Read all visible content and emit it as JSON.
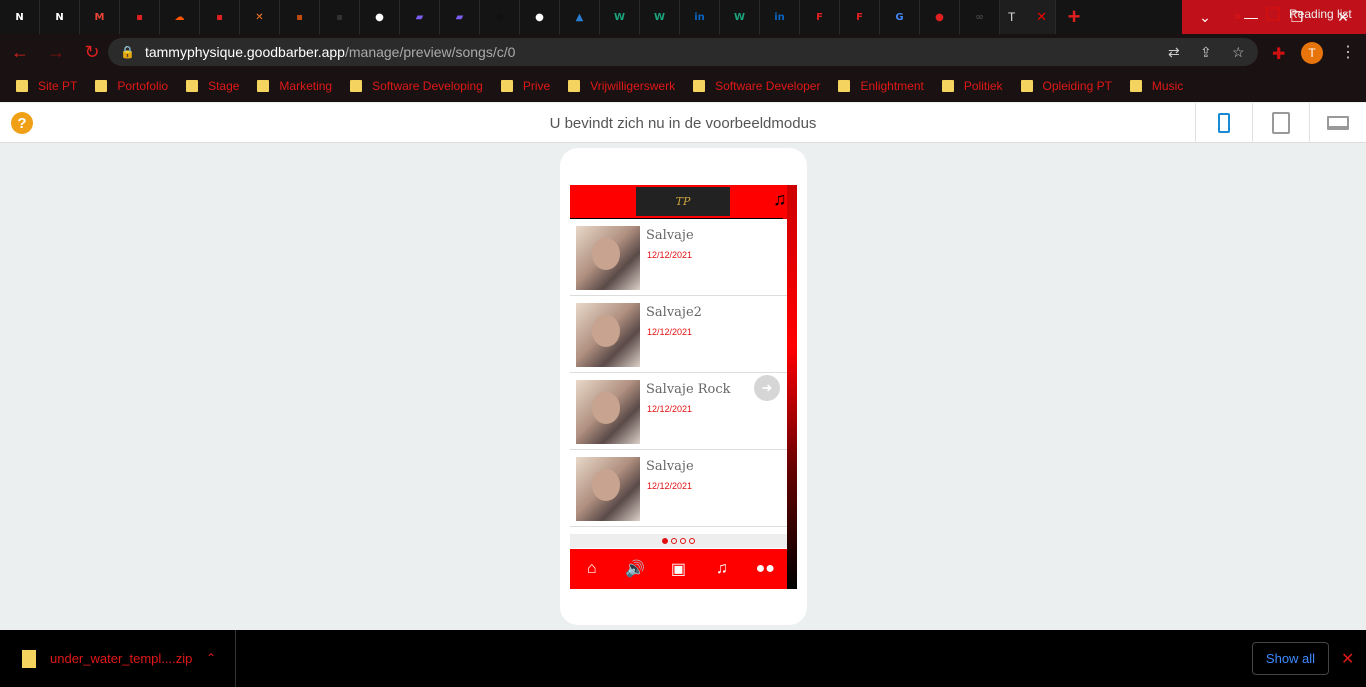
{
  "browser": {
    "tabs": [
      {
        "icon": "nch-icon",
        "color": "#ffffff",
        "glyph": "N"
      },
      {
        "icon": "nch-icon",
        "color": "#ffffff",
        "glyph": "N"
      },
      {
        "icon": "gmail-icon",
        "color": "#ea4335",
        "glyph": "M"
      },
      {
        "icon": "app-icon",
        "color": "#e02020",
        "glyph": "▪"
      },
      {
        "icon": "soundcloud-icon",
        "color": "#ff5500",
        "glyph": "☁"
      },
      {
        "icon": "app-icon",
        "color": "#e02020",
        "glyph": "▪"
      },
      {
        "icon": "xampp-icon",
        "color": "#fb7a24",
        "glyph": "✕"
      },
      {
        "icon": "app-icon",
        "color": "#c04a10",
        "glyph": "▪"
      },
      {
        "icon": "app-icon",
        "color": "#333333",
        "glyph": "▪"
      },
      {
        "icon": "github-icon",
        "color": "#ffffff",
        "glyph": "●"
      },
      {
        "icon": "app-icon",
        "color": "#7b5cf0",
        "glyph": "▰"
      },
      {
        "icon": "app-icon",
        "color": "#7b5cf0",
        "glyph": "▰"
      },
      {
        "icon": "app-icon",
        "color": "#111111",
        "glyph": "●"
      },
      {
        "icon": "github-icon",
        "color": "#ffffff",
        "glyph": "●"
      },
      {
        "icon": "app-icon",
        "color": "#2a7fd4",
        "glyph": "▲"
      },
      {
        "icon": "w-icon",
        "color": "#1aa37a",
        "glyph": "W"
      },
      {
        "icon": "w-icon",
        "color": "#1aa37a",
        "glyph": "W"
      },
      {
        "icon": "linkedin-icon",
        "color": "#0a66c2",
        "glyph": "in"
      },
      {
        "icon": "w-icon",
        "color": "#1aa37a",
        "glyph": "W"
      },
      {
        "icon": "linkedin-icon",
        "color": "#0a66c2",
        "glyph": "in"
      },
      {
        "icon": "f-icon",
        "color": "#e02020",
        "glyph": "F"
      },
      {
        "icon": "f-icon",
        "color": "#e02020",
        "glyph": "F"
      },
      {
        "icon": "google-icon",
        "color": "#4285f4",
        "glyph": "G"
      },
      {
        "icon": "app-icon",
        "color": "#e02020",
        "glyph": "●"
      },
      {
        "icon": "app-icon",
        "color": "#444444",
        "glyph": "∞"
      }
    ],
    "active_tab": {
      "label": "T",
      "close": "✕"
    },
    "new_tab": "+",
    "window": {
      "dropdown": "⌄",
      "minimize": "—",
      "restore": "❐",
      "close": "✕"
    },
    "address": {
      "host": "tammyphysique.goodbarber.app",
      "path": "/manage/preview/songs/c/0"
    },
    "profile_initial": "T",
    "bookmarks": [
      "Site PT",
      "Portofolio",
      "Stage",
      "Marketing",
      "Software Developing",
      "Prive",
      "Vrijwilligerswerk",
      "Software Developer",
      "Enlightment",
      "Politiek",
      "Opleiding PT",
      "Music"
    ],
    "bookmarks_more": "»",
    "reading_list": "Reading list"
  },
  "preview": {
    "title": "U bevindt zich nu in de voorbeeldmodus",
    "help": "?"
  },
  "app": {
    "logo_text": "TP",
    "songs": [
      {
        "title": "Salvaje",
        "date": "12/12/2021"
      },
      {
        "title": "Salvaje2",
        "date": "12/12/2021"
      },
      {
        "title": "Salvaje Rock",
        "date": "12/12/2021"
      },
      {
        "title": "Salvaje",
        "date": "12/12/2021"
      }
    ],
    "pager_active": 1,
    "pager_count": 4,
    "tabbar": [
      {
        "icon": "home-icon",
        "glyph": "⌂"
      },
      {
        "icon": "speaker-icon",
        "glyph": "🔊"
      },
      {
        "icon": "video-icon",
        "glyph": "▣"
      },
      {
        "icon": "music-icon",
        "glyph": "♫"
      },
      {
        "icon": "more-icon",
        "glyph": "●●"
      }
    ]
  },
  "downloads": {
    "file": "under_water_templ....zip",
    "show_all": "Show all"
  }
}
